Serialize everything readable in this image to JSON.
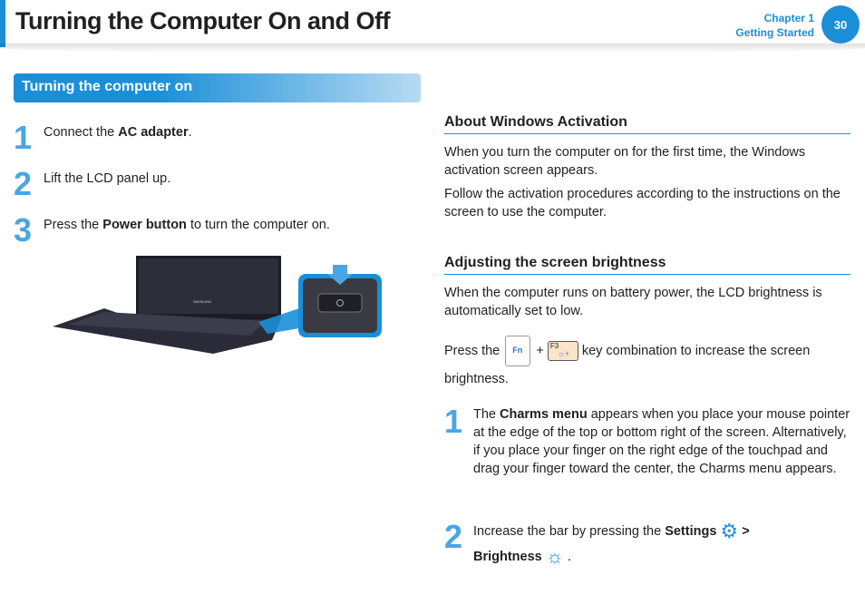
{
  "header": {
    "title": "Turning the Computer On and Off",
    "chapter": "Chapter 1",
    "chapter_name": "Getting Started",
    "page": "30",
    "accent": "#1a8fd8"
  },
  "left": {
    "section_title": "Turning the computer on",
    "steps": [
      {
        "num": "1",
        "pre": "Connect the ",
        "bold": "AC adapter",
        "post": "."
      },
      {
        "num": "2",
        "pre": "Lift the LCD panel up.",
        "bold": "",
        "post": ""
      },
      {
        "num": "3",
        "pre": "Press the ",
        "bold": "Power button",
        "post": " to turn the computer on."
      }
    ],
    "laptop_brand": "SAMSUNG"
  },
  "right": {
    "activation": {
      "heading": "About Windows Activation",
      "p1": "When you turn the computer on for the first time, the Windows activation screen appears.",
      "p2": "Follow the activation procedures according to the instructions on the screen to use the computer."
    },
    "brightness": {
      "heading": "Adjusting the screen brightness",
      "p1": "When the computer runs on battery power, the LCD brightness is automatically set to low.",
      "press_pre": "Press the",
      "fn_key": "Fn",
      "plus": "+",
      "f3_key": "F3",
      "press_post": "key combination to increase the screen brightness.",
      "steps": [
        {
          "num": "1",
          "pre": "The ",
          "bold": "Charms menu",
          "post": " appears when you place your mouse pointer at the edge of the top or bottom right of the screen. Alternatively, if you place your finger on the right edge of the touchpad and drag your finger toward the center, the Charms menu appears."
        },
        {
          "num": "2",
          "pre": "Increase the bar by pressing the ",
          "bold": "Settings",
          "sep": ">",
          "bold2": "Brightness",
          "end": "."
        }
      ]
    }
  }
}
